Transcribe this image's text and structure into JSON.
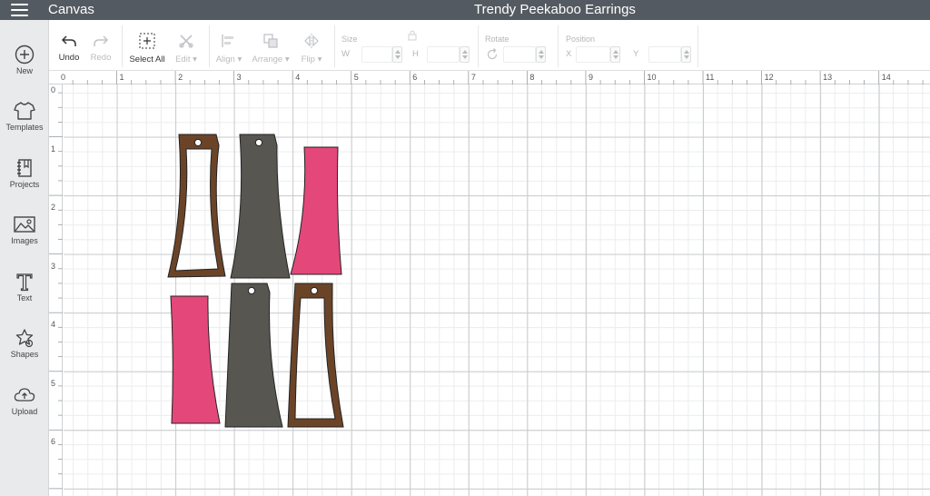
{
  "header": {
    "app_title": "Canvas",
    "project_title": "Trendy Peekaboo Earrings",
    "bar_color": "#545a61"
  },
  "sidebar": {
    "items": [
      {
        "label": "New",
        "icon": "plus-circle-icon"
      },
      {
        "label": "Templates",
        "icon": "tshirt-icon"
      },
      {
        "label": "Projects",
        "icon": "notebook-icon"
      },
      {
        "label": "Images",
        "icon": "image-icon"
      },
      {
        "label": "Text",
        "icon": "text-t-icon"
      },
      {
        "label": "Shapes",
        "icon": "shapes-icon"
      },
      {
        "label": "Upload",
        "icon": "cloud-upload-icon"
      }
    ]
  },
  "toolbar": {
    "undo_label": "Undo",
    "redo_label": "Redo",
    "select_all_label": "Select All",
    "edit_label": "Edit",
    "align_label": "Align",
    "arrange_label": "Arrange",
    "flip_label": "Flip",
    "size_label": "Size",
    "w_label": "W",
    "h_label": "H",
    "rotate_label": "Rotate",
    "position_label": "Position",
    "x_label": "X",
    "y_label": "Y"
  },
  "rulers": {
    "top_labels": [
      "0",
      "1",
      "2",
      "3",
      "4",
      "5",
      "6",
      "7",
      "8",
      "9",
      "10",
      "11",
      "12",
      "13",
      "14"
    ],
    "left_labels": [
      "0",
      "1",
      "2",
      "3",
      "4",
      "5",
      "6"
    ]
  },
  "colors": {
    "brown": "#6b4428",
    "gray": "#585650",
    "pink": "#e4487a"
  }
}
